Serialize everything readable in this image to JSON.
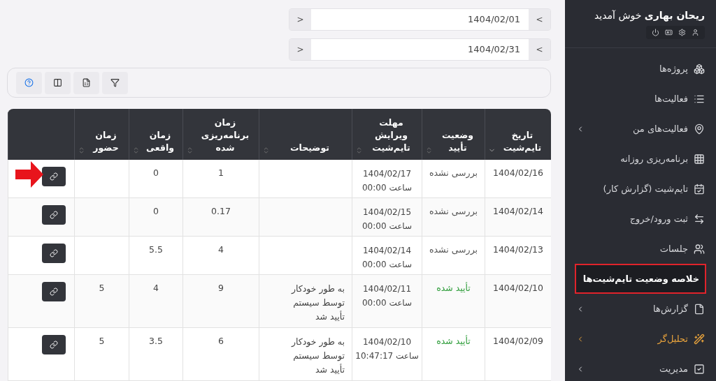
{
  "sidebar": {
    "greeting": "**ریحان بهاری** خوش آمدید",
    "items": [
      {
        "label": "پروژه‌ها",
        "has_submenu": false,
        "selected": false,
        "accent": false
      },
      {
        "label": "فعالیت‌ها",
        "has_submenu": false,
        "selected": false,
        "accent": false
      },
      {
        "label": "فعالیت‌های من",
        "has_submenu": true,
        "selected": false,
        "accent": false
      },
      {
        "label": "برنامه‌ریزی روزانه",
        "has_submenu": false,
        "selected": false,
        "accent": false
      },
      {
        "label": "تایم‌شیت (گزارش کار)",
        "has_submenu": false,
        "selected": false,
        "accent": false
      },
      {
        "label": "ثبت ورود/خروج",
        "has_submenu": false,
        "selected": false,
        "accent": false
      },
      {
        "label": "جلسات",
        "has_submenu": false,
        "selected": false,
        "accent": false
      },
      {
        "label": "خلاصه وضعیت تایم‌شیت‌ها",
        "has_submenu": false,
        "selected": true,
        "accent": false
      },
      {
        "label": "گزارش‌ها",
        "has_submenu": true,
        "selected": false,
        "accent": false
      },
      {
        "label": "تحلیل‌گر",
        "has_submenu": true,
        "selected": false,
        "accent": true
      },
      {
        "label": "مدیریت",
        "has_submenu": true,
        "selected": false,
        "accent": false
      }
    ]
  },
  "date_range": [
    {
      "value": "1404/02/01",
      "prev": "<",
      "next": ">"
    },
    {
      "value": "1404/02/31",
      "prev": "<",
      "next": ">"
    }
  ],
  "table": {
    "columns": [
      {
        "label": "تاریخ\nتایم‌شیت",
        "sortable": true,
        "sorted": true
      },
      {
        "label": "وضعیت\nتأیید",
        "sortable": true,
        "sorted": false
      },
      {
        "label": "مهلت\nویرایش\nتایم‌شیت",
        "sortable": true,
        "sorted": false
      },
      {
        "label": "توضیحات",
        "sortable": true,
        "sorted": false
      },
      {
        "label": "زمان\nبرنامه‌ریزی\nشده",
        "sortable": true,
        "sorted": false
      },
      {
        "label": "زمان\nواقعی",
        "sortable": true,
        "sorted": false
      },
      {
        "label": "زمان\nحضور",
        "sortable": true,
        "sorted": false
      },
      {
        "sortable": false
      }
    ],
    "rows": [
      {
        "date": "1404/02/16",
        "status": "بررسی نشده",
        "approved": false,
        "deadline": "1404/02/17\nساعت 00:00",
        "planned": "1",
        "actual": "0",
        "pointer": true
      },
      {
        "date": "1404/02/14",
        "status": "بررسی نشده",
        "approved": false,
        "deadline": "1404/02/15\nساعت 00:00",
        "planned": "0.17",
        "actual": "0",
        "pointer": false
      },
      {
        "date": "1404/02/13",
        "status": "بررسی نشده",
        "approved": false,
        "deadline": "1404/02/14\nساعت 00:00",
        "planned": "4",
        "actual": "5.5",
        "pointer": false
      },
      {
        "date": "1404/02/10",
        "status": "تأیید شده",
        "approved": true,
        "deadline": "1404/02/11\nساعت 00:00",
        "description": "به طور خودکار\nتوسط سیستم\nتأیید شد",
        "planned": "9",
        "actual": "4",
        "presence": "5",
        "pointer": false
      },
      {
        "date": "1404/02/09",
        "status": "تأیید شده",
        "approved": true,
        "deadline": "1404/02/10\nساعت 10:47:17",
        "description": "به طور خودکار\nتوسط سیستم\nتأیید شد",
        "planned": "6",
        "actual": "3.5",
        "presence": "5",
        "pointer": false
      }
    ]
  }
}
